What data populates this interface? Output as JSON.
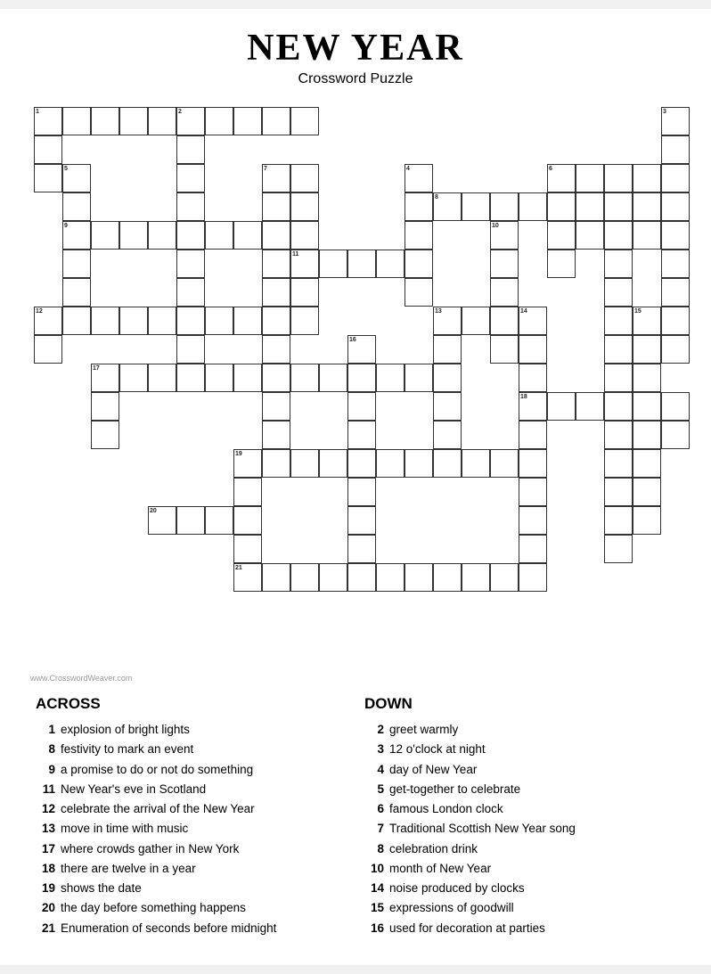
{
  "title": "NEW YEAR",
  "subtitle": "Crossword Puzzle",
  "watermark": "www.CrosswordWeaver.com",
  "across_heading": "ACROSS",
  "down_heading": "DOWN",
  "across_clues": [
    {
      "num": "1",
      "text": "explosion of bright lights"
    },
    {
      "num": "8",
      "text": "festivity to mark an event"
    },
    {
      "num": "9",
      "text": "a promise to do or not do something"
    },
    {
      "num": "11",
      "text": "New Year's eve in Scotland"
    },
    {
      "num": "12",
      "text": "celebrate the arrival of the New Year"
    },
    {
      "num": "13",
      "text": "move in time with music"
    },
    {
      "num": "17",
      "text": "where crowds gather in New York"
    },
    {
      "num": "18",
      "text": "there are twelve in a year"
    },
    {
      "num": "19",
      "text": "shows the date"
    },
    {
      "num": "20",
      "text": "the day before something happens"
    },
    {
      "num": "21",
      "text": "Enumeration of seconds before midnight"
    }
  ],
  "down_clues": [
    {
      "num": "2",
      "text": "greet warmly"
    },
    {
      "num": "3",
      "text": "12 o'clock at night"
    },
    {
      "num": "4",
      "text": "day of New Year"
    },
    {
      "num": "5",
      "text": "get-together to celebrate"
    },
    {
      "num": "6",
      "text": "famous London clock"
    },
    {
      "num": "7",
      "text": "Traditional Scottish New Year song"
    },
    {
      "num": "8",
      "text": "celebration drink"
    },
    {
      "num": "10",
      "text": "month of New Year"
    },
    {
      "num": "14",
      "text": "noise produced by clocks"
    },
    {
      "num": "15",
      "text": "expressions of goodwill"
    },
    {
      "num": "16",
      "text": "used for decoration at parties"
    }
  ]
}
